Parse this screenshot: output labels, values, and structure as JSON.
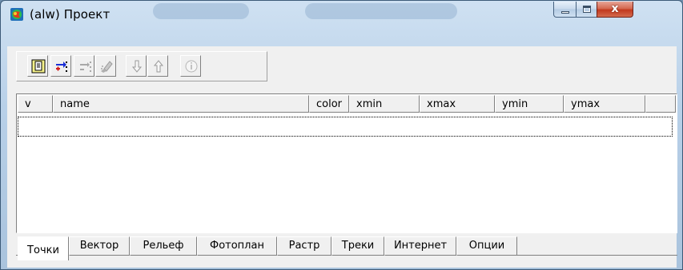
{
  "window": {
    "title": "(alw) Проект",
    "caption": {
      "close_glyph": "x",
      "min_glyph": "-",
      "max_glyph": "□"
    }
  },
  "toolbar": {
    "buttons": [
      {
        "name": "new-item-icon",
        "enabled": true
      },
      {
        "name": "add-point-icon",
        "enabled": true
      },
      {
        "name": "remove-point-icon",
        "enabled": false
      },
      {
        "name": "erase-icon",
        "enabled": false
      },
      {
        "name": "move-down-icon",
        "enabled": false
      },
      {
        "name": "move-up-icon",
        "enabled": false
      },
      {
        "name": "info-icon",
        "enabled": false
      }
    ]
  },
  "grid": {
    "columns": [
      "v",
      "name",
      "color",
      "xmin",
      "xmax",
      "ymin",
      "ymax"
    ],
    "rows": []
  },
  "tabs": {
    "items": [
      "Точки",
      "Вектор",
      "Рельеф",
      "Фотоплан",
      "Растр",
      "Треки",
      "Интернет",
      "Опции"
    ],
    "active": "Точки"
  }
}
